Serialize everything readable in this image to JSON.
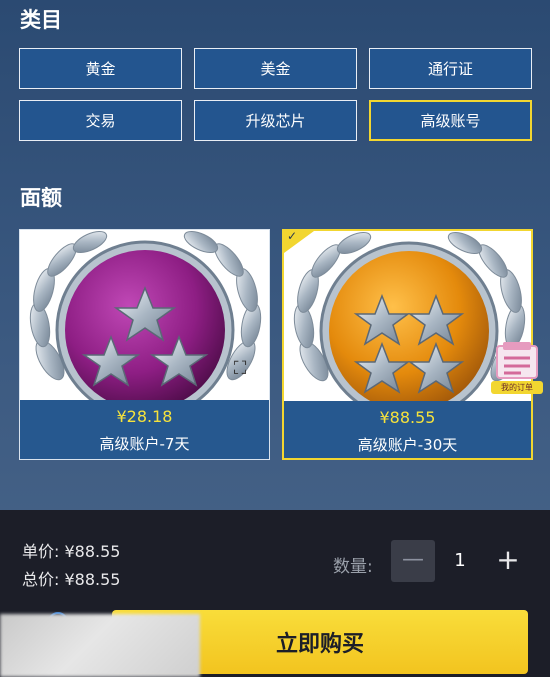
{
  "category": {
    "title": "类目",
    "items": [
      {
        "label": "黄金",
        "selected": false
      },
      {
        "label": "美金",
        "selected": false
      },
      {
        "label": "通行证",
        "selected": false
      },
      {
        "label": "交易",
        "selected": false
      },
      {
        "label": "升级芯片",
        "selected": false
      },
      {
        "label": "高级账号",
        "selected": true
      }
    ]
  },
  "denomination": {
    "title": "面额",
    "cards": [
      {
        "price": "¥28.18",
        "name": "高级账户-7天",
        "ball_color": "#8e1e84",
        "selected": false,
        "icon": "silver-three-star-badge-icon"
      },
      {
        "price": "¥88.55",
        "name": "高级账户-30天",
        "ball_color": "#e48a0c",
        "selected": true,
        "icon": "silver-four-star-badge-icon"
      }
    ]
  },
  "floating_widget": {
    "label": "我的订单"
  },
  "summary": {
    "unit_price": "单价: ¥88.55",
    "total_price": "总价: ¥88.55"
  },
  "quantity": {
    "label": "数量:",
    "value": "1",
    "minus": "—",
    "plus": "+"
  },
  "buy_button": {
    "label": "立即购买"
  },
  "colors": {
    "accent_yellow": "#f2d630",
    "button_blue": "#23558f",
    "bottom_bar": "#1c1e28"
  }
}
